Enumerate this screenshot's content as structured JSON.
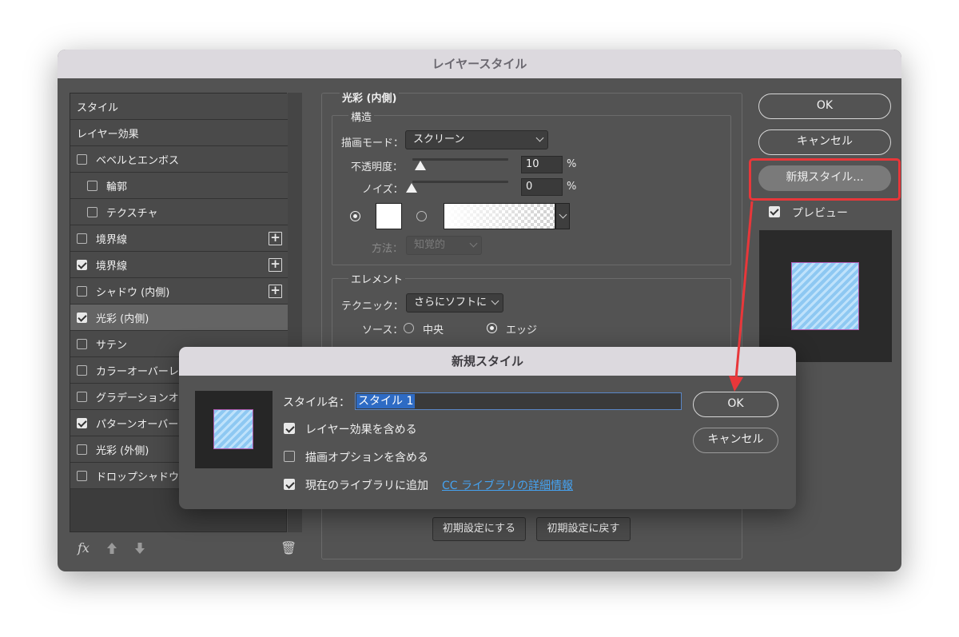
{
  "main_dialog": {
    "title": "レイヤースタイル",
    "left_list": [
      {
        "label": "スタイル",
        "checkbox": null
      },
      {
        "label": "レイヤー効果",
        "checkbox": null
      },
      {
        "label": "ベベルとエンボス",
        "checkbox": false
      },
      {
        "label": "輪郭",
        "checkbox": false
      },
      {
        "label": "テクスチャ",
        "checkbox": false
      },
      {
        "label": "境界線",
        "checkbox": false,
        "plus": "+"
      },
      {
        "label": "境界線",
        "checkbox": true,
        "plus": "+"
      },
      {
        "label": "シャドウ (内側)",
        "checkbox": false,
        "plus": "+"
      },
      {
        "label": "光彩 (内側)",
        "checkbox": true,
        "selected": true
      },
      {
        "label": "サテン",
        "checkbox": false
      },
      {
        "label": "カラーオーバーレ",
        "checkbox": false
      },
      {
        "label": "グラデーションオ",
        "checkbox": false
      },
      {
        "label": "パターンオーバー",
        "checkbox": true
      },
      {
        "label": "光彩 (外側)",
        "checkbox": false
      },
      {
        "label": "ドロップシャドウ",
        "checkbox": false
      }
    ],
    "bottom_bar": {
      "fx": "fx",
      "trash": "🗑"
    },
    "panel": {
      "title": "光彩 (内側)",
      "structure": {
        "title": "構造",
        "blend_mode_label": "描画モード：",
        "blend_mode_value": "スクリーン",
        "opacity_label": "不透明度：",
        "opacity_value": "10",
        "opacity_unit": "%",
        "noise_label": "ノイズ：",
        "noise_value": "0",
        "noise_unit": "%",
        "method_label": "方法：",
        "method_value": "知覚的"
      },
      "elements": {
        "title": "エレメント",
        "technique_label": "テクニック：",
        "technique_value": "さらにソフトに",
        "source_label": "ソース：",
        "source_center": "中央",
        "source_edge": "エッジ"
      },
      "buttons": {
        "make_default": "初期設定にする",
        "reset_default": "初期設定に戻す"
      }
    },
    "right": {
      "ok": "OK",
      "cancel": "キャンセル",
      "new_style": "新規スタイル...",
      "preview_label": "プレビュー"
    }
  },
  "new_style_dialog": {
    "title": "新規スタイル",
    "name_label": "スタイル名：",
    "name_value": "スタイル 1",
    "include_effects": "レイヤー効果を含める",
    "include_blending": "描画オプションを含める",
    "add_to_library": "現在のライブラリに追加",
    "library_link": "CC ライブラリの詳細情報",
    "ok": "OK",
    "cancel": "キャンセル"
  },
  "colors": {
    "dialog_bg": "#535353",
    "title_bar": "#dcd9de",
    "highlight_red": "#e8373a",
    "link_blue": "#45a2f0",
    "selection_blue": "#2e6bc4"
  }
}
